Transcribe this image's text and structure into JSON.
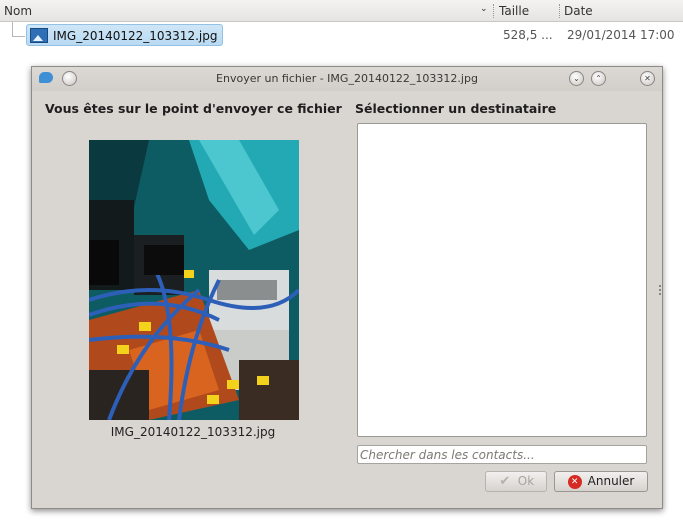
{
  "file_manager": {
    "columns": {
      "name": "Nom",
      "size": "Taille",
      "date": "Date"
    },
    "sort_indicator_icon": "chevron-down-icon",
    "file": {
      "name": "IMG_20140122_103312.jpg",
      "size": "528,5 ...",
      "date": "29/01/2014 17:00",
      "icon": "image-file-icon"
    }
  },
  "dialog": {
    "title": "Envoyer un fichier - IMG_20140122_103312.jpg",
    "left_heading": "Vous êtes sur le point d'envoyer ce fichier",
    "right_heading": "Sélectionner un destinataire",
    "preview_caption": "IMG_20140122_103312.jpg",
    "search_placeholder": "Chercher dans les contacts...",
    "ok_label": "Ok",
    "cancel_label": "Annuler",
    "ok_enabled": false
  },
  "colors": {
    "selection": "#bcdcf3",
    "dialog_bg": "#d9d5d1",
    "cancel_icon": "#d62a23"
  }
}
